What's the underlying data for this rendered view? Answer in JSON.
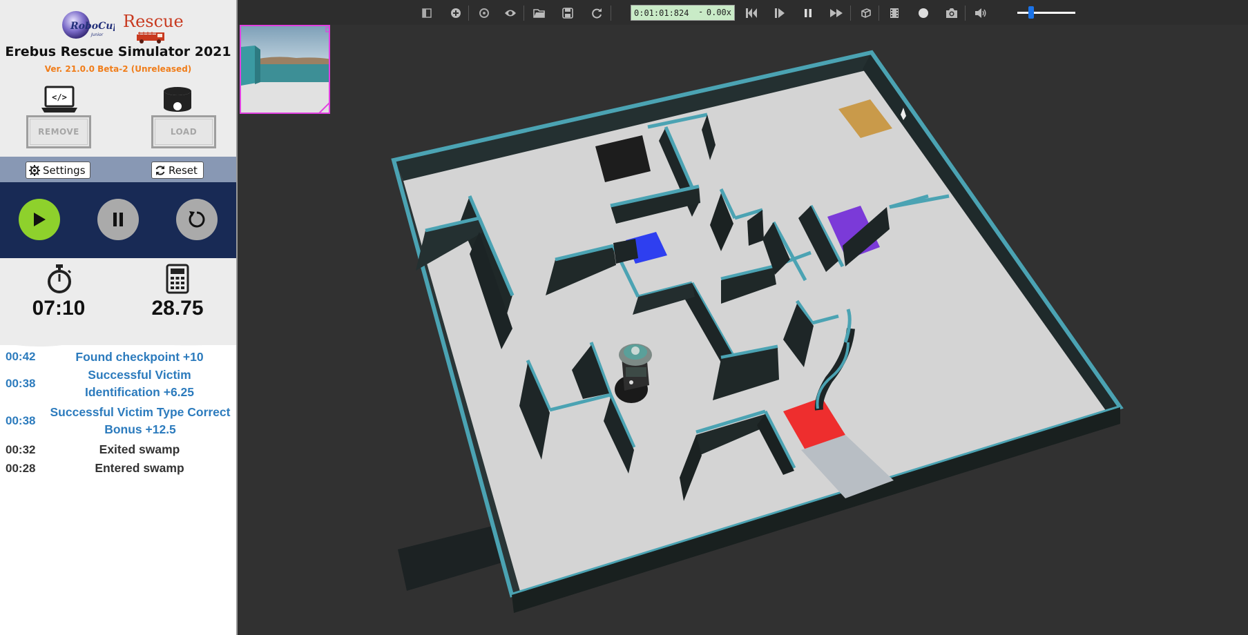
{
  "panel": {
    "rcj_logo_text": "RoboCup",
    "rcj_logo_sub": "Junior",
    "rescue_logo_text": "Rescue",
    "title": "Erebus Rescue Simulator 2021",
    "version": "Ver. 21.0.0 Beta-2 (Unreleased)",
    "remove_label": "REMOVE",
    "load_label": "LOAD",
    "settings_label": "Settings",
    "reset_label": "Reset",
    "timer": "07:10",
    "score": "28.75"
  },
  "log": [
    {
      "time": "00:42",
      "message": "Found checkpoint +10",
      "style": "blue"
    },
    {
      "time": "00:38",
      "message": "Successful Victim Identification +6.25",
      "style": "blue"
    },
    {
      "time": "00:38",
      "message": "Successful Victim Type Correct Bonus +12.5",
      "style": "blue"
    },
    {
      "time": "00:32",
      "message": "Exited swamp",
      "style": "dark"
    },
    {
      "time": "00:28",
      "message": "Entered swamp",
      "style": "dark"
    }
  ],
  "toolbar": {
    "sim_time": "0:01:01:824",
    "time_sep": "-",
    "speed": "0.00x",
    "volume": 0.2
  },
  "colors": {
    "play_green": "#8ed12c",
    "panel_navy": "#182a55",
    "settings_bar": "#8898b4",
    "log_blue": "#2c7bbd",
    "version_orange": "#f07d1a",
    "wall_teal": "#4ba3b3",
    "tile_orange": "#c99a4a",
    "tile_blue": "#2e3ff0",
    "tile_purple": "#7b3ad8",
    "tile_red": "#ee2e2e"
  }
}
